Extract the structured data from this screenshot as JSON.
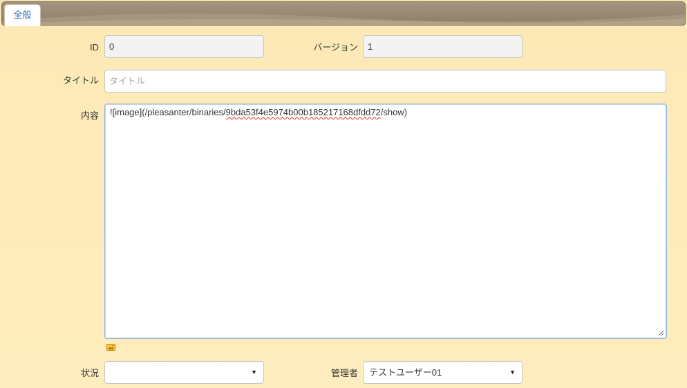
{
  "tabs": [
    {
      "label": "全般"
    }
  ],
  "form": {
    "id": {
      "label": "ID",
      "value": "0"
    },
    "version": {
      "label": "バージョン",
      "value": "1"
    },
    "title": {
      "label": "タイトル",
      "value": "",
      "placeholder": "タイトル"
    },
    "body": {
      "label": "内容",
      "value_prefix": "![image](/pleasanter/binaries/",
      "value_misspelled": "9bda53f4e5974b00b185217168dfdd72",
      "value_suffix": "/show)"
    },
    "status": {
      "label": "状況",
      "value": ""
    },
    "manager": {
      "label": "管理者",
      "value": "テストユーザー01"
    }
  },
  "icons": {
    "image_upload": "image-icon",
    "dropdown": "chevron-down-icon",
    "resize": "resize-grip-icon"
  },
  "colors": {
    "background": "#fdebb8",
    "tab_text": "#2a70b8",
    "focus_border": "#8fb2de",
    "spellcheck": "#e0302a",
    "icon_accent": "#e2a20c"
  }
}
